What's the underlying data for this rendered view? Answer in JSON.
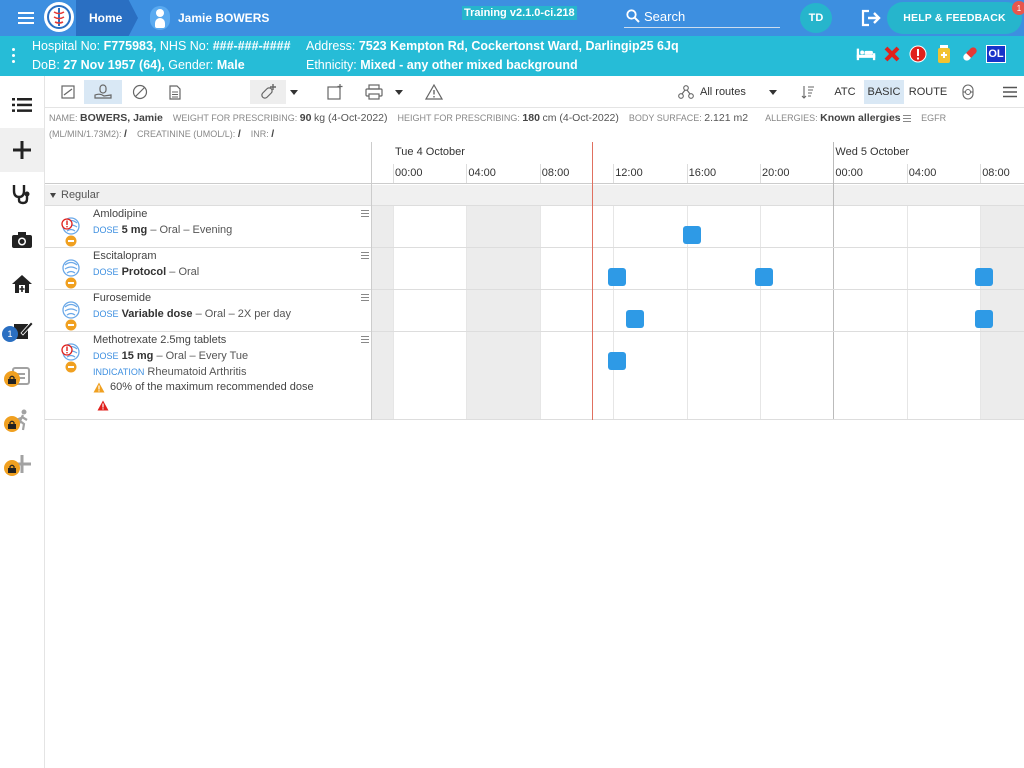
{
  "topbar": {
    "home": "Home",
    "patient": "Jamie BOWERS",
    "version": "Training v2.1.0-ci.218",
    "search_label": "Search",
    "avatar_initials": "TD",
    "help": "HELP & FEEDBACK",
    "help_badge": "1"
  },
  "banner": {
    "hosp_label": "Hospital No:",
    "hosp_no": "F775983,",
    "nhs_label": "NHS No:",
    "nhs_no": "###-###-####",
    "dob_label": "DoB:",
    "dob": "27 Nov 1957 (64),",
    "gender_label": "Gender:",
    "gender": "Male",
    "address_label": "Address:",
    "address": "7523 Kempton Rd, Cockertonst Ward, Darlingip25 6Jq",
    "ethnicity_label": "Ethnicity:",
    "ethnicity": "Mixed - any other mixed background",
    "ol_badge": "OL"
  },
  "nav": {
    "notification_count": "1"
  },
  "toolbar": {
    "routes": "All routes",
    "atc": "ATC",
    "basic": "BASIC",
    "route": "ROUTE"
  },
  "info": {
    "name_label": "NAME:",
    "name": "BOWERS, Jamie",
    "weight_label": "WEIGHT FOR PRESCRIBING:",
    "weight_value": "90",
    "weight_unit": "kg (4-Oct-2022)",
    "height_label": "HEIGHT FOR PRESCRIBING:",
    "height_value": "180",
    "height_unit": "cm (4-Oct-2022)",
    "bsa_label": "BODY SURFACE:",
    "bsa_value": "2.121 m2",
    "allergies_label": "ALLERGIES:",
    "allergies_value": "Known allergies",
    "egfr_label": "EGFR",
    "egfr_unit": "(ML/MIN/1.73M2):",
    "egfr_value": "/",
    "creat_label": "CREATININE (UMOL/L):",
    "creat_value": "/",
    "inr_label": "INR:",
    "inr_value": "/"
  },
  "chart": {
    "days": [
      "Tue 4 October",
      "Wed 5 October"
    ],
    "hours": [
      "00:00",
      "04:00",
      "08:00",
      "12:00",
      "16:00",
      "20:00",
      "00:00",
      "04:00",
      "08:00"
    ],
    "group": "Regular",
    "meds": [
      {
        "name": "Amlodipine",
        "dose_label": "DOSE",
        "dose": "5 mg",
        "detail": "– Oral – Evening",
        "dose_times_hours": [
          16.3
        ]
      },
      {
        "name": "Escitalopram",
        "dose_label": "DOSE",
        "dose": "Protocol",
        "detail": "– Oral",
        "dose_times_hours": [
          12.2,
          20.2,
          32.2
        ]
      },
      {
        "name": "Furosemide",
        "dose_label": "DOSE",
        "dose": "Variable dose",
        "detail": "– Oral – 2X per day",
        "dose_times_hours": [
          13.2,
          32.2
        ]
      },
      {
        "name": "Methotrexate 2.5mg tablets",
        "dose_label": "DOSE",
        "dose": "15 mg",
        "detail": "– Oral – Every Tue",
        "indication_label": "INDICATION",
        "indication": "Rheumatoid Arthritis",
        "warning": "60% of the maximum recommended dose",
        "dose_times_hours": [
          12.2
        ]
      }
    ]
  },
  "colors": {
    "topbar": "#3d8fe0",
    "banner": "#26bcd7",
    "dose_box": "#2e9ae6",
    "now_line": "#e07060"
  }
}
